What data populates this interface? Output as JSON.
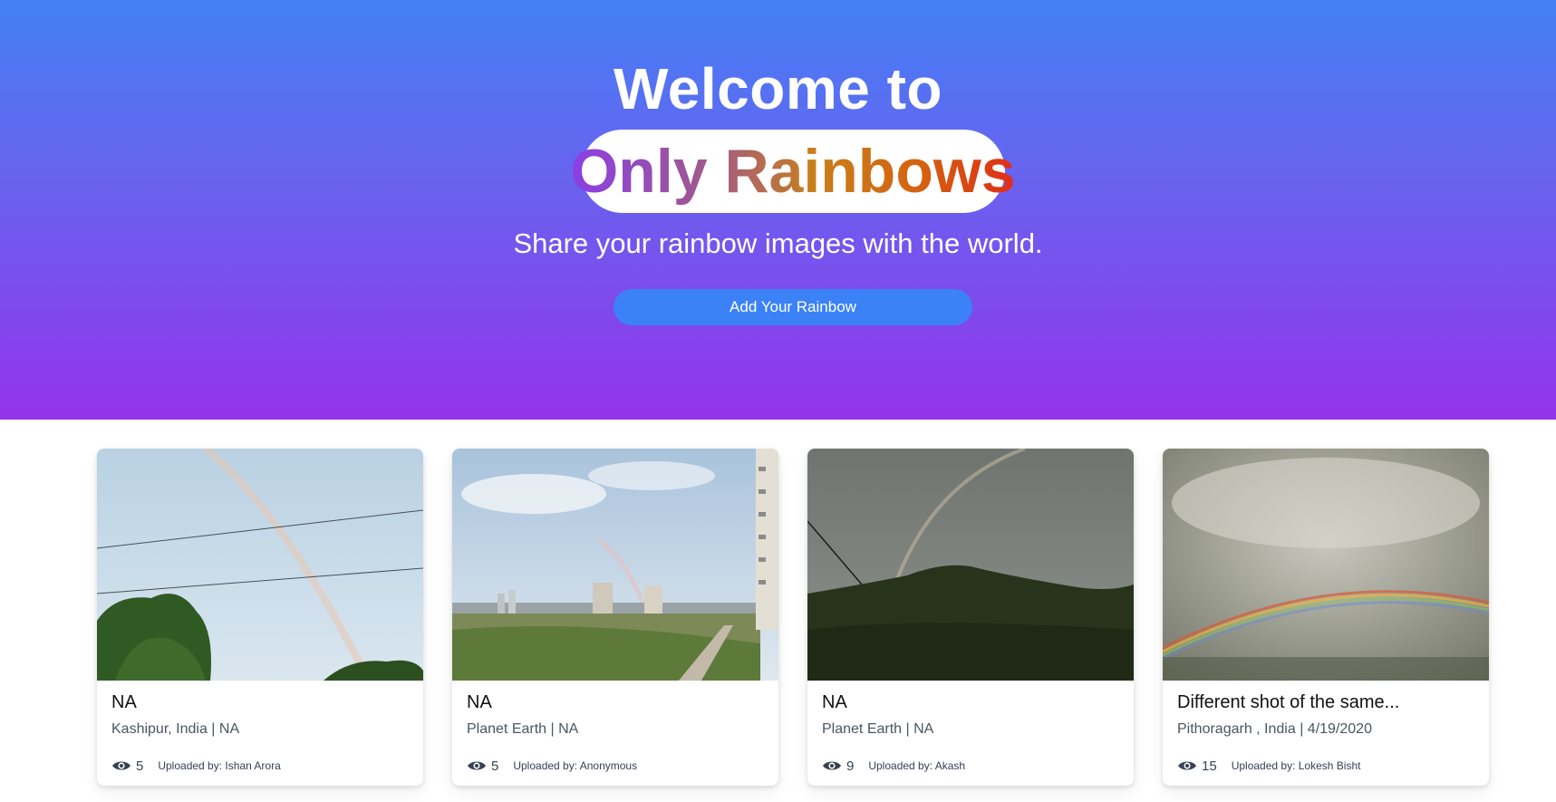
{
  "hero": {
    "title": "Welcome to",
    "brand": "Only Rainbows",
    "subtitle": "Share your rainbow images with the world.",
    "cta_label": "Add Your Rainbow",
    "gradient_colors": [
      "#4380f6",
      "#9433ea"
    ],
    "cta_color": "#3b82f6"
  },
  "cards": [
    {
      "title": "NA",
      "meta": "Kashipur, India | NA",
      "views": "5",
      "uploader": "Uploaded by: Ishan Arora",
      "icon": "eye-icon"
    },
    {
      "title": "NA",
      "meta": "Planet Earth | NA",
      "views": "5",
      "uploader": "Uploaded by: Anonymous",
      "icon": "eye-icon"
    },
    {
      "title": "NA",
      "meta": "Planet Earth | NA",
      "views": "9",
      "uploader": "Uploaded by: Akash",
      "icon": "eye-icon"
    },
    {
      "title": "Different shot of the same...",
      "meta": "Pithoragarh , India | 4/19/2020",
      "views": "15",
      "uploader": "Uploaded by: Lokesh Bisht",
      "icon": "eye-icon"
    }
  ]
}
